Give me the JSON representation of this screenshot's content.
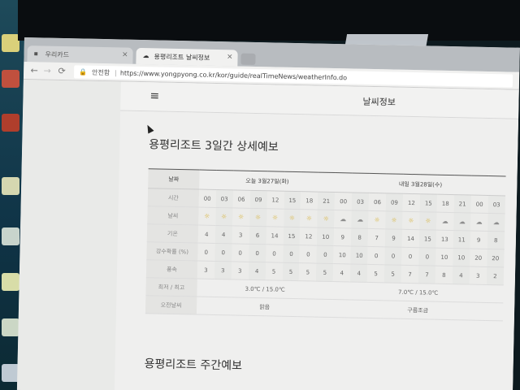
{
  "browser": {
    "tabs": [
      {
        "label": "우리카드"
      },
      {
        "label": "용평리조트 날씨정보"
      }
    ],
    "address": {
      "secure_label": "안전함",
      "url": "https://www.yongpyong.co.kr/kor/guide/realTimeNews/weatherInfo.do"
    }
  },
  "header": {
    "menu_icon": "hamburger-icon",
    "title": "날씨정보"
  },
  "forecast3": {
    "title": "용평리조트 3일간 상세예보",
    "date_label": "날짜",
    "days": [
      "오늘 3월27일(화)",
      "내일 3월28일(수)"
    ],
    "row_labels": {
      "time": "시간",
      "weather": "날씨",
      "temp": "기온",
      "precip": "강수확률 (%)",
      "wind": "풍속",
      "minmax": "최저 / 최고",
      "summary": "오전날씨"
    },
    "times": [
      "00",
      "03",
      "06",
      "09",
      "12",
      "15",
      "18",
      "21",
      "00",
      "03",
      "06",
      "09",
      "12",
      "15",
      "18",
      "21",
      "00",
      "03"
    ],
    "weather": [
      "sun",
      "sun",
      "sun",
      "sun",
      "sun",
      "sun",
      "sun",
      "sun",
      "cloud",
      "cloud",
      "sun",
      "sun",
      "sun",
      "sun",
      "cloud",
      "cloud",
      "cloud",
      "cloud"
    ],
    "temps": [
      "4",
      "4",
      "3",
      "6",
      "14",
      "15",
      "12",
      "10",
      "9",
      "8",
      "7",
      "9",
      "14",
      "15",
      "13",
      "11",
      "9",
      "8"
    ],
    "precip": [
      "0",
      "0",
      "0",
      "0",
      "0",
      "0",
      "0",
      "0",
      "10",
      "10",
      "0",
      "0",
      "0",
      "0",
      "10",
      "10",
      "20",
      "20"
    ],
    "wind": [
      "3",
      "3",
      "3",
      "4",
      "5",
      "5",
      "5",
      "5",
      "4",
      "4",
      "5",
      "5",
      "7",
      "7",
      "8",
      "4",
      "3",
      "2"
    ],
    "minmax": [
      "3.0℃ / 15.0℃",
      "7.0℃ / 15.0℃"
    ],
    "summary": [
      "맑음",
      "구름조금"
    ]
  },
  "weekly": {
    "title": "용평리조트 주간예보"
  },
  "colors": {
    "sun": "#d8b43c",
    "cloud": "#8d8d8d"
  }
}
